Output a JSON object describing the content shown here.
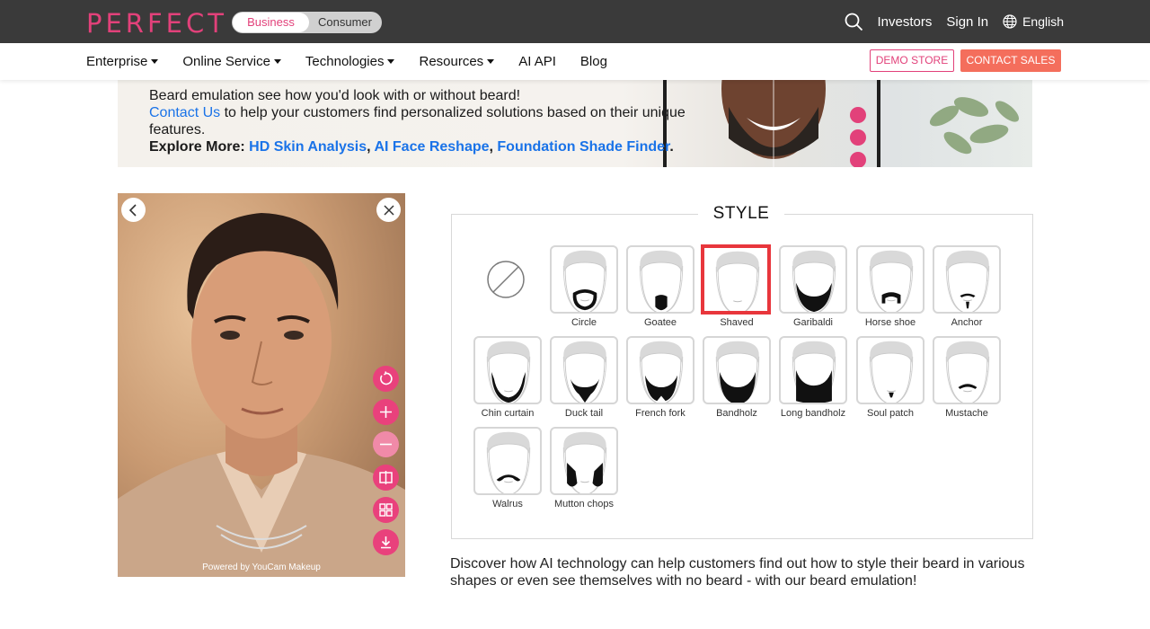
{
  "header": {
    "logo": "PERFECT",
    "segment": {
      "active": "Business",
      "inactive": "Consumer"
    },
    "links": {
      "investors": "Investors",
      "sign_in": "Sign In",
      "language": "English"
    },
    "icons": {
      "search": "search-icon",
      "globe": "globe-icon"
    }
  },
  "nav": {
    "items": [
      {
        "label": "Enterprise",
        "dropdown": true
      },
      {
        "label": "Online Service",
        "dropdown": true
      },
      {
        "label": "Technologies",
        "dropdown": true
      },
      {
        "label": "Resources",
        "dropdown": true
      },
      {
        "label": "AI API",
        "dropdown": false
      },
      {
        "label": "Blog",
        "dropdown": false
      }
    ],
    "demo_store": "DEMO STORE",
    "contact_sales": "CONTACT SALES"
  },
  "banner": {
    "line1": "Beard emulation see how you'd look with or without beard!",
    "contact_link": "Contact Us",
    "line2": " to help your customers find personalized solutions based on their unique features.",
    "explore_label": "Explore More: ",
    "explore_links": [
      "HD Skin Analysis",
      "AI Face Reshape",
      "Foundation Shade Finder"
    ],
    "sep": ", ",
    "end": "."
  },
  "photo": {
    "powered_by": "Powered by YouCam Makeup",
    "tools": [
      "undo-icon",
      "zoom-in-icon",
      "zoom-out-icon",
      "compare-icon",
      "layout-icon",
      "download-icon"
    ]
  },
  "style_panel": {
    "title": "STYLE",
    "selected": "Shaved",
    "styles": [
      "Circle",
      "Goatee",
      "Shaved",
      "Garibaldi",
      "Horse shoe",
      "Anchor",
      "Chin curtain",
      "Duck tail",
      "French fork",
      "Bandholz",
      "Long bandholz",
      "Soul patch",
      "Mustache",
      "Walrus",
      "Mutton chops"
    ]
  },
  "description": "Discover how AI technology can help customers find out how to style their beard in various shapes or even see themselves with no beard - with our beard emulation!",
  "colors": {
    "brand_pink": "#e2417a",
    "contact_orange": "#f46e5c",
    "selected_red": "#e8363c",
    "link_blue": "#1a73e8"
  }
}
